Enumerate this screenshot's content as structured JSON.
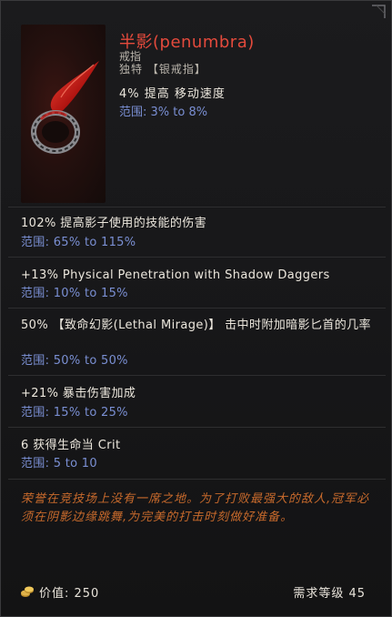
{
  "item": {
    "name": "半影(penumbra)",
    "type": "戒指",
    "rarity": "独特 【银戒指】",
    "implicit": "4% 提高 移动速度",
    "implicit_range": "范围: 3% to 8%"
  },
  "affixes": [
    {
      "text": "102% 提高影子使用的技能的伤害",
      "range": "范围: 65% to 115%"
    },
    {
      "text": "+13% Physical Penetration with Shadow Daggers",
      "range": "范围: 10% to 15%"
    },
    {
      "text": "50% 【致命幻影(Lethal Mirage)】 击中时附加暗影匕首的几率",
      "range": "范围: 50% to 50%"
    },
    {
      "text": "+21% 暴击伤害加成",
      "range": "范围: 15% to 25%"
    },
    {
      "text": "6 获得生命当 Crit",
      "range": "范围: 5 to 10"
    }
  ],
  "flavor": "荣誉在竞技场上没有一席之地。为了打败最强大的敌人,冠军必须在阴影边缘跳舞,为完美的打击时刻做好准备。",
  "footer": {
    "price": "价值: 250",
    "requirement": "需求等级 45"
  },
  "icons": {
    "item_art": "ring-icon",
    "coin": "coin-icon",
    "corner": "corner-ornament-icon"
  },
  "colors": {
    "name": "#e44a3c",
    "range": "#7a8fd3",
    "flavor": "#c86a2c"
  }
}
